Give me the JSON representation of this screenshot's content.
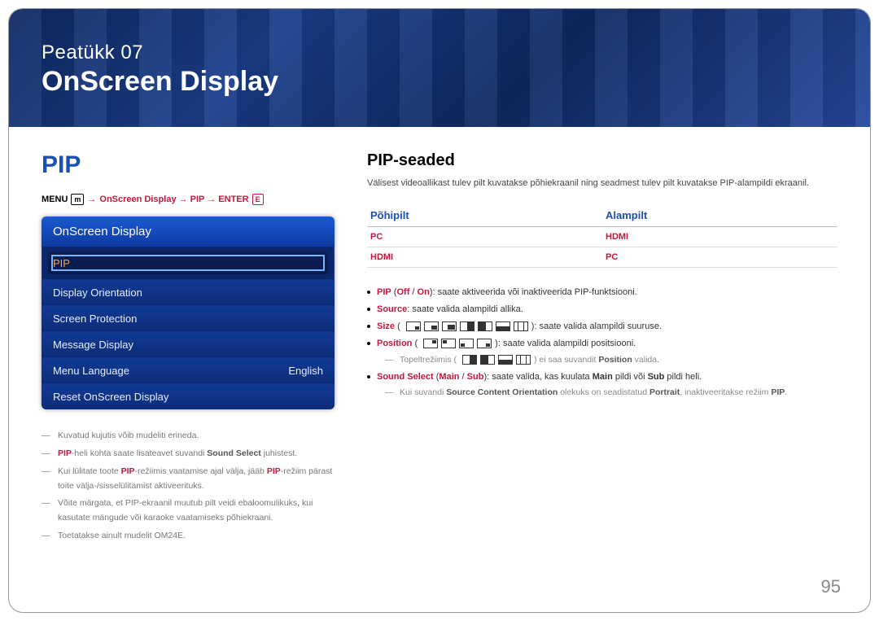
{
  "chapter": {
    "prefix": "Peatükk 07",
    "title": "OnScreen Display"
  },
  "section_title": "PIP",
  "breadcrumb": {
    "menu": "MENU",
    "menu_glyph": "m",
    "path": "OnScreen Display → PIP → ENTER",
    "enter_glyph": "E"
  },
  "osd": {
    "title": "OnScreen Display",
    "items": [
      {
        "label": "PIP",
        "value": "",
        "selected": true
      },
      {
        "label": "Display Orientation",
        "value": ""
      },
      {
        "label": "Screen Protection",
        "value": ""
      },
      {
        "label": "Message Display",
        "value": ""
      },
      {
        "label": "Menu Language",
        "value": "English"
      },
      {
        "label": "Reset OnScreen Display",
        "value": ""
      }
    ]
  },
  "footnotes": [
    {
      "text": "Kuvatud kujutis võib mudeliti erineda."
    },
    {
      "html_parts": [
        {
          "t": "plain",
          "v": ""
        },
        {
          "t": "red",
          "v": "PIP"
        },
        {
          "t": "plain",
          "v": "-heli kohta saate lisateavet suvandi "
        },
        {
          "t": "b",
          "v": "Sound Select"
        },
        {
          "t": "plain",
          "v": " juhistest."
        }
      ]
    },
    {
      "html_parts": [
        {
          "t": "plain",
          "v": "Kui lülitate toote "
        },
        {
          "t": "red",
          "v": "PIP"
        },
        {
          "t": "plain",
          "v": "-režiimis vaatamise ajal välja, jääb "
        },
        {
          "t": "red",
          "v": "PIP"
        },
        {
          "t": "plain",
          "v": "-režiim pärast toite välja-/sisselülitamist aktiveerituks."
        }
      ]
    },
    {
      "text": "Võite märgata, et PIP-ekraanil muutub pilt veidi ebaloomulikuks, kui kasutate mängude või karaoke vaatamiseks põhiekraani."
    },
    {
      "text": "Toetatakse ainult mudelit OM24E."
    }
  ],
  "right": {
    "heading": "PIP-seaded",
    "intro": "Välisest videoallikast tulev pilt kuvatakse põhiekraanil ning seadmest tulev pilt kuvatakse PIP-alampildi ekraanil.",
    "table": {
      "head": [
        "Põhipilt",
        "Alampilt"
      ],
      "rows": [
        [
          "PC",
          "HDMI"
        ],
        [
          "HDMI",
          "PC"
        ]
      ]
    },
    "bullets": {
      "pip_label": "PIP",
      "off": "Off",
      "on": "On",
      "pip_text": ": saate aktiveerida või inaktiveerida PIP-funktsiooni.",
      "source_label": "Source",
      "source_text": ": saate valida alampildi allika.",
      "size_label": "Size",
      "size_text": ": saate valida alampildi suuruse.",
      "position_label": "Position",
      "position_text": ": saate valida alampildi positsiooni.",
      "position_sub_pre": "Topeltrežiimis (",
      "position_sub_post": ") ei saa suvandit ",
      "position_sub_label": "Position",
      "position_sub_end": " valida.",
      "sound_label": "Sound Select",
      "sound_main": "Main",
      "sound_sub": "Sub",
      "sound_text_pre": " (",
      "sound_text_mid": " / ",
      "sound_text_post": "): saate valida, kas kuulata ",
      "sound_text_end": " pildi heli.",
      "orientation_pre": "Kui suvandi ",
      "orientation_sco": "Source Content Orientation",
      "orientation_mid": " olekuks on seadistatud ",
      "orientation_portrait": "Portrait",
      "orientation_post": ", inaktiveeritakse režiim ",
      "orientation_pip": "PIP",
      "orientation_end": "."
    }
  },
  "page_number": "95"
}
